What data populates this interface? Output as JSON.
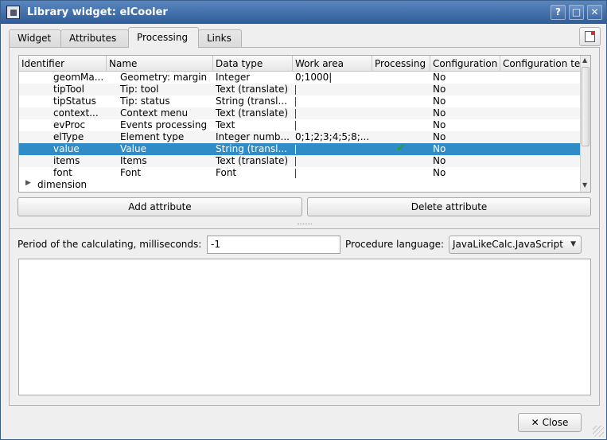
{
  "window": {
    "title": "Library widget: elCooler",
    "buttons": {
      "help": "?",
      "maximize": "□",
      "close": "✕"
    }
  },
  "tabs": [
    "Widget",
    "Attributes",
    "Processing",
    "Links"
  ],
  "active_tab": "Processing",
  "table": {
    "columns": [
      "Identifier",
      "Name",
      "Data type",
      "Work area",
      "Processing",
      "Configuration",
      "Configuration te"
    ],
    "rows": [
      {
        "id": "geomMa...",
        "name": "Geometry: margin",
        "type": "Integer",
        "work": "0;1000|",
        "processing": "",
        "config": "No"
      },
      {
        "id": "tipTool",
        "name": "Tip: tool",
        "type": "Text (translate)",
        "work": "|",
        "processing": "",
        "config": "No"
      },
      {
        "id": "tipStatus",
        "name": "Tip: status",
        "type": "String (transl...",
        "work": "|",
        "processing": "",
        "config": "No"
      },
      {
        "id": "context...",
        "name": "Context menu",
        "type": "Text (translate)",
        "work": "|",
        "processing": "",
        "config": "No"
      },
      {
        "id": "evProc",
        "name": "Events processing",
        "type": "Text",
        "work": "|",
        "processing": "",
        "config": "No"
      },
      {
        "id": "elType",
        "name": "Element type",
        "type": "Integer numb...",
        "work": "0;1;2;3;4;5;8;...",
        "processing": "",
        "config": "No"
      },
      {
        "id": "value",
        "name": "Value",
        "type": "String (transl...",
        "work": "|",
        "processing": "checked",
        "config": "No"
      },
      {
        "id": "items",
        "name": "Items",
        "type": "Text (translate)",
        "work": "|",
        "processing": "",
        "config": "No"
      },
      {
        "id": "font",
        "name": "Font",
        "type": "Font",
        "work": "|",
        "processing": "",
        "config": "No"
      }
    ],
    "group_row": "dimension",
    "selected_row": "value"
  },
  "buttons": {
    "add_attribute": "Add attribute",
    "delete_attribute": "Delete attribute",
    "close": "Close"
  },
  "processing": {
    "period_label": "Period of the calculating, milliseconds:",
    "period_value": "-1",
    "language_label": "Procedure language:",
    "language_value": "JavaLikeCalc.JavaScript"
  },
  "colors": {
    "titlebar": "#2e5d99",
    "selection": "#308cc6",
    "check": "#2aa12a"
  }
}
